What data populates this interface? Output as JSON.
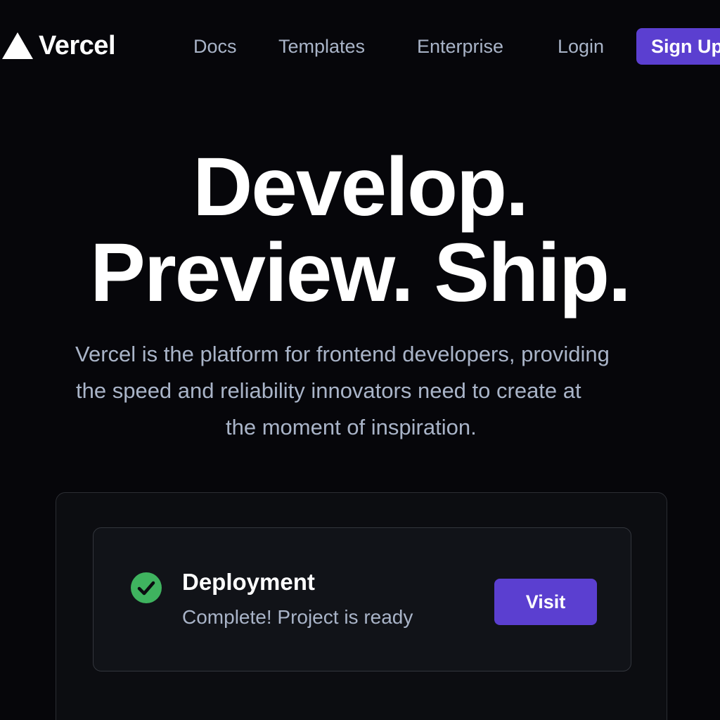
{
  "header": {
    "brand": "Vercel",
    "nav": {
      "docs": "Docs",
      "templates": "Templates",
      "enterprise": "Enterprise",
      "login": "Login"
    },
    "signup_label": "Sign Up"
  },
  "hero": {
    "title_line1": "Develop.",
    "title_line2": "Preview. Ship.",
    "subtitle_line1": "Vercel is the platform for frontend developers, providing",
    "subtitle_line2": "the speed and reliability innovators need to create at",
    "subtitle_line3": "the moment of inspiration."
  },
  "deployment": {
    "title": "Deployment",
    "status": "Complete! Project is ready",
    "status_icon": "check-circle-icon",
    "visit_label": "Visit"
  },
  "colors": {
    "background": "#06060a",
    "accent": "#5b3fd0",
    "success": "#3fb35f",
    "muted_text": "#a9b4c8"
  }
}
